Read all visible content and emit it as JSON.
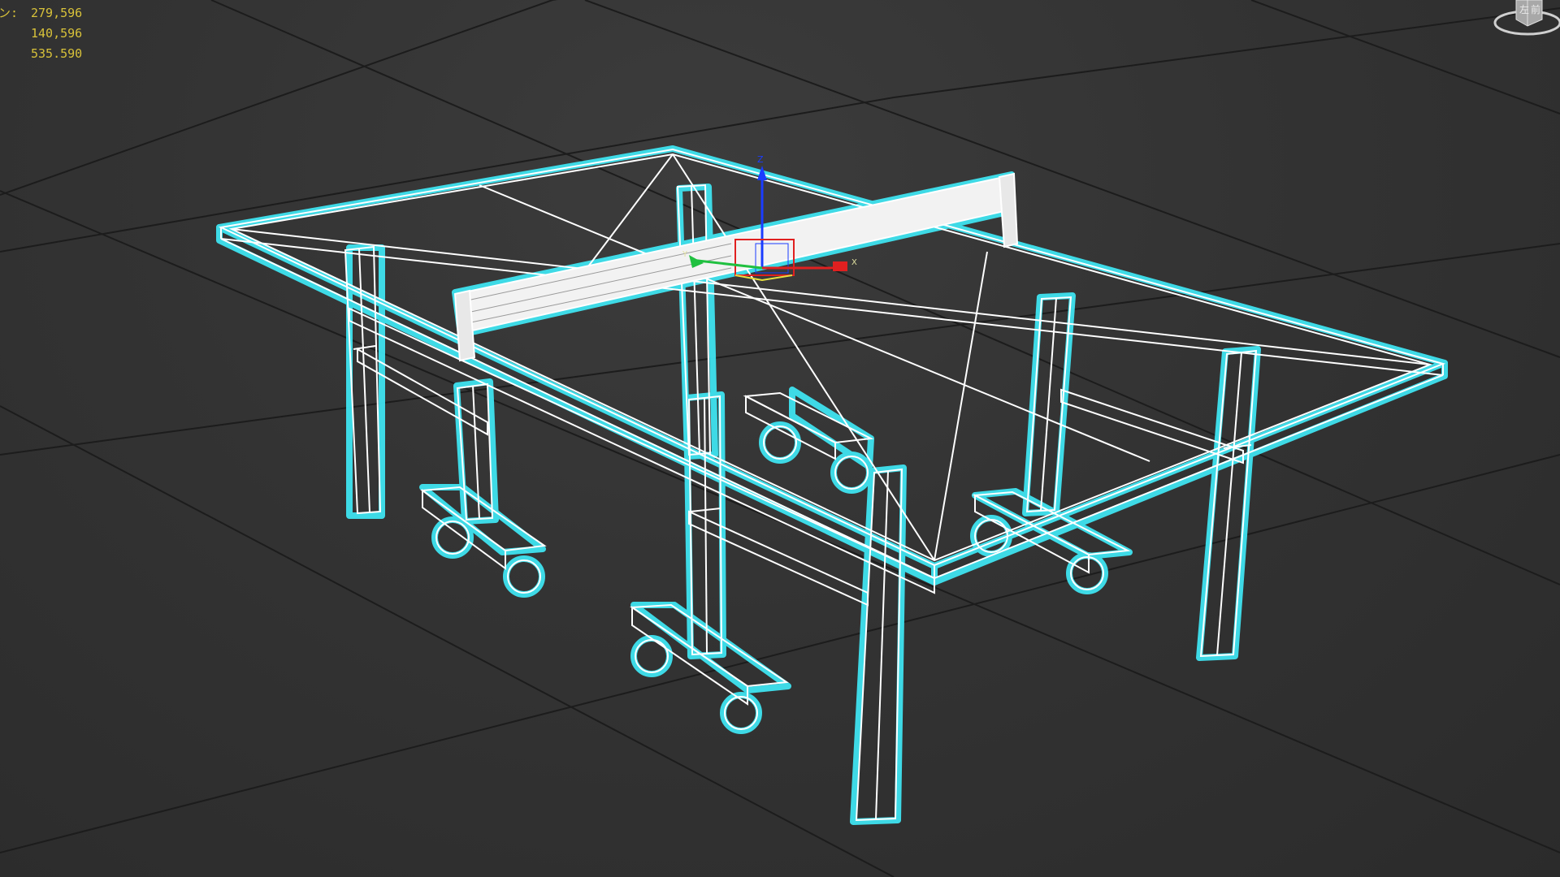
{
  "viewport": {
    "stats": {
      "row1_label": "ン:",
      "row1_value": "279,596",
      "row2_value": "140,596",
      "row3_value": "535.590"
    },
    "viewcube": {
      "face_top_label": "前",
      "face_side_label": "左"
    },
    "gizmo": {
      "z_label": "Z",
      "x_label": "X",
      "y_label": "Y"
    },
    "colors": {
      "selection": "#3fe3f0",
      "wireframe": "#ffffff",
      "stats_text": "#d8c23a",
      "gizmo_z": "#1a3cff",
      "gizmo_x": "#e02020",
      "gizmo_y": "#20c040"
    }
  }
}
